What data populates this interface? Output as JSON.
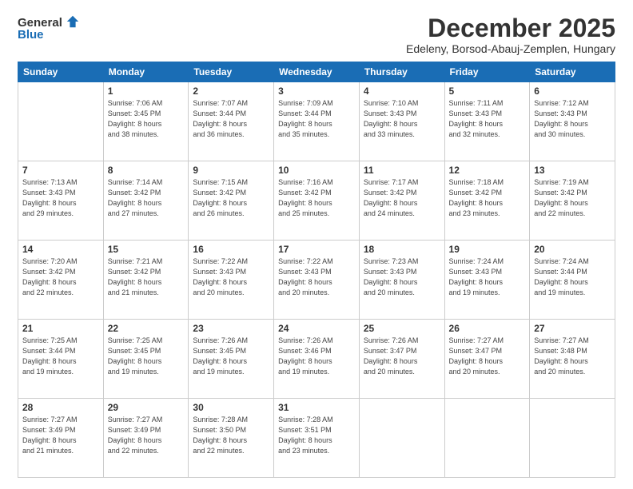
{
  "header": {
    "logo_general": "General",
    "logo_blue": "Blue",
    "month_title": "December 2025",
    "location": "Edeleny, Borsod-Abauj-Zemplen, Hungary"
  },
  "weekdays": [
    "Sunday",
    "Monday",
    "Tuesday",
    "Wednesday",
    "Thursday",
    "Friday",
    "Saturday"
  ],
  "weeks": [
    [
      {
        "day": "",
        "sunrise": "",
        "sunset": "",
        "daylight": ""
      },
      {
        "day": "1",
        "sunrise": "Sunrise: 7:06 AM",
        "sunset": "Sunset: 3:45 PM",
        "daylight": "Daylight: 8 hours and 38 minutes."
      },
      {
        "day": "2",
        "sunrise": "Sunrise: 7:07 AM",
        "sunset": "Sunset: 3:44 PM",
        "daylight": "Daylight: 8 hours and 36 minutes."
      },
      {
        "day": "3",
        "sunrise": "Sunrise: 7:09 AM",
        "sunset": "Sunset: 3:44 PM",
        "daylight": "Daylight: 8 hours and 35 minutes."
      },
      {
        "day": "4",
        "sunrise": "Sunrise: 7:10 AM",
        "sunset": "Sunset: 3:43 PM",
        "daylight": "Daylight: 8 hours and 33 minutes."
      },
      {
        "day": "5",
        "sunrise": "Sunrise: 7:11 AM",
        "sunset": "Sunset: 3:43 PM",
        "daylight": "Daylight: 8 hours and 32 minutes."
      },
      {
        "day": "6",
        "sunrise": "Sunrise: 7:12 AM",
        "sunset": "Sunset: 3:43 PM",
        "daylight": "Daylight: 8 hours and 30 minutes."
      }
    ],
    [
      {
        "day": "7",
        "sunrise": "Sunrise: 7:13 AM",
        "sunset": "Sunset: 3:43 PM",
        "daylight": "Daylight: 8 hours and 29 minutes."
      },
      {
        "day": "8",
        "sunrise": "Sunrise: 7:14 AM",
        "sunset": "Sunset: 3:42 PM",
        "daylight": "Daylight: 8 hours and 27 minutes."
      },
      {
        "day": "9",
        "sunrise": "Sunrise: 7:15 AM",
        "sunset": "Sunset: 3:42 PM",
        "daylight": "Daylight: 8 hours and 26 minutes."
      },
      {
        "day": "10",
        "sunrise": "Sunrise: 7:16 AM",
        "sunset": "Sunset: 3:42 PM",
        "daylight": "Daylight: 8 hours and 25 minutes."
      },
      {
        "day": "11",
        "sunrise": "Sunrise: 7:17 AM",
        "sunset": "Sunset: 3:42 PM",
        "daylight": "Daylight: 8 hours and 24 minutes."
      },
      {
        "day": "12",
        "sunrise": "Sunrise: 7:18 AM",
        "sunset": "Sunset: 3:42 PM",
        "daylight": "Daylight: 8 hours and 23 minutes."
      },
      {
        "day": "13",
        "sunrise": "Sunrise: 7:19 AM",
        "sunset": "Sunset: 3:42 PM",
        "daylight": "Daylight: 8 hours and 22 minutes."
      }
    ],
    [
      {
        "day": "14",
        "sunrise": "Sunrise: 7:20 AM",
        "sunset": "Sunset: 3:42 PM",
        "daylight": "Daylight: 8 hours and 22 minutes."
      },
      {
        "day": "15",
        "sunrise": "Sunrise: 7:21 AM",
        "sunset": "Sunset: 3:42 PM",
        "daylight": "Daylight: 8 hours and 21 minutes."
      },
      {
        "day": "16",
        "sunrise": "Sunrise: 7:22 AM",
        "sunset": "Sunset: 3:43 PM",
        "daylight": "Daylight: 8 hours and 20 minutes."
      },
      {
        "day": "17",
        "sunrise": "Sunrise: 7:22 AM",
        "sunset": "Sunset: 3:43 PM",
        "daylight": "Daylight: 8 hours and 20 minutes."
      },
      {
        "day": "18",
        "sunrise": "Sunrise: 7:23 AM",
        "sunset": "Sunset: 3:43 PM",
        "daylight": "Daylight: 8 hours and 20 minutes."
      },
      {
        "day": "19",
        "sunrise": "Sunrise: 7:24 AM",
        "sunset": "Sunset: 3:43 PM",
        "daylight": "Daylight: 8 hours and 19 minutes."
      },
      {
        "day": "20",
        "sunrise": "Sunrise: 7:24 AM",
        "sunset": "Sunset: 3:44 PM",
        "daylight": "Daylight: 8 hours and 19 minutes."
      }
    ],
    [
      {
        "day": "21",
        "sunrise": "Sunrise: 7:25 AM",
        "sunset": "Sunset: 3:44 PM",
        "daylight": "Daylight: 8 hours and 19 minutes."
      },
      {
        "day": "22",
        "sunrise": "Sunrise: 7:25 AM",
        "sunset": "Sunset: 3:45 PM",
        "daylight": "Daylight: 8 hours and 19 minutes."
      },
      {
        "day": "23",
        "sunrise": "Sunrise: 7:26 AM",
        "sunset": "Sunset: 3:45 PM",
        "daylight": "Daylight: 8 hours and 19 minutes."
      },
      {
        "day": "24",
        "sunrise": "Sunrise: 7:26 AM",
        "sunset": "Sunset: 3:46 PM",
        "daylight": "Daylight: 8 hours and 19 minutes."
      },
      {
        "day": "25",
        "sunrise": "Sunrise: 7:26 AM",
        "sunset": "Sunset: 3:47 PM",
        "daylight": "Daylight: 8 hours and 20 minutes."
      },
      {
        "day": "26",
        "sunrise": "Sunrise: 7:27 AM",
        "sunset": "Sunset: 3:47 PM",
        "daylight": "Daylight: 8 hours and 20 minutes."
      },
      {
        "day": "27",
        "sunrise": "Sunrise: 7:27 AM",
        "sunset": "Sunset: 3:48 PM",
        "daylight": "Daylight: 8 hours and 20 minutes."
      }
    ],
    [
      {
        "day": "28",
        "sunrise": "Sunrise: 7:27 AM",
        "sunset": "Sunset: 3:49 PM",
        "daylight": "Daylight: 8 hours and 21 minutes."
      },
      {
        "day": "29",
        "sunrise": "Sunrise: 7:27 AM",
        "sunset": "Sunset: 3:49 PM",
        "daylight": "Daylight: 8 hours and 22 minutes."
      },
      {
        "day": "30",
        "sunrise": "Sunrise: 7:28 AM",
        "sunset": "Sunset: 3:50 PM",
        "daylight": "Daylight: 8 hours and 22 minutes."
      },
      {
        "day": "31",
        "sunrise": "Sunrise: 7:28 AM",
        "sunset": "Sunset: 3:51 PM",
        "daylight": "Daylight: 8 hours and 23 minutes."
      },
      {
        "day": "",
        "sunrise": "",
        "sunset": "",
        "daylight": ""
      },
      {
        "day": "",
        "sunrise": "",
        "sunset": "",
        "daylight": ""
      },
      {
        "day": "",
        "sunrise": "",
        "sunset": "",
        "daylight": ""
      }
    ]
  ]
}
